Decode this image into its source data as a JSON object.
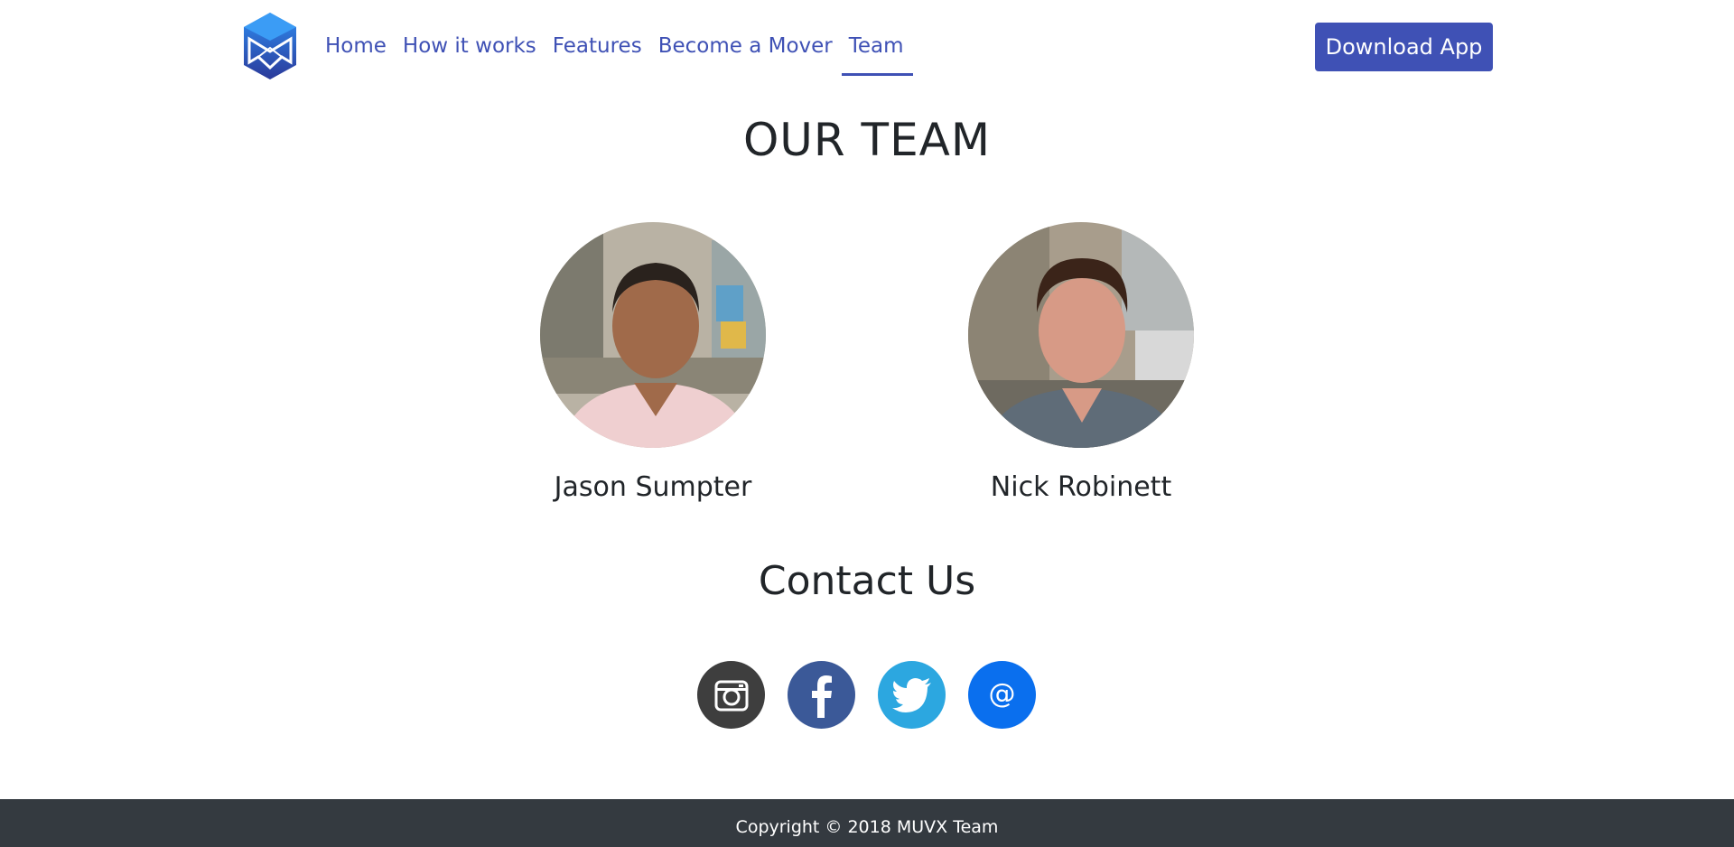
{
  "navbar": {
    "logo_icon": "muvx-cube-logo-icon",
    "links": [
      {
        "label": "Home",
        "active": false
      },
      {
        "label": "How it works",
        "active": false
      },
      {
        "label": "Features",
        "active": false
      },
      {
        "label": "Become a Mover",
        "active": false
      },
      {
        "label": "Team",
        "active": true
      }
    ],
    "download_label": "Download App",
    "accent_color": "#3f51b5"
  },
  "team": {
    "title": "OUR TEAM",
    "members": [
      {
        "name": "Jason Sumpter",
        "photo": "avatar-photo"
      },
      {
        "name": "Nick Robinett",
        "photo": "avatar-photo"
      }
    ]
  },
  "contact": {
    "title": "Contact Us",
    "socials": [
      {
        "icon": "instagram-icon",
        "color": "#3e3e3e"
      },
      {
        "icon": "facebook-icon",
        "color": "#3b5998"
      },
      {
        "icon": "twitter-icon",
        "color": "#2ca7e0"
      },
      {
        "icon": "email-icon",
        "color": "#0a6fee",
        "glyph": "@"
      }
    ]
  },
  "footer": {
    "text": "Copyright © 2018 MUVX Team",
    "background": "#343a40"
  }
}
